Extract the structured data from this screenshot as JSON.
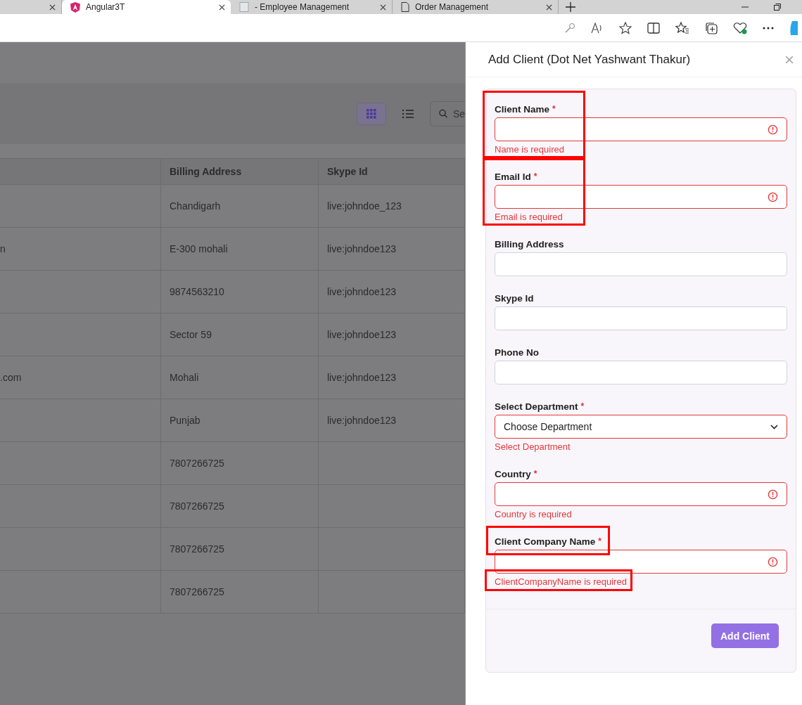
{
  "browser": {
    "tabs": [
      {
        "selected": false
      },
      {
        "title": "Angular3T",
        "selected": true
      },
      {
        "title": "- Employee Management",
        "selected": false
      },
      {
        "title": "Order Management",
        "selected": false
      }
    ]
  },
  "page": {
    "toolbar": {
      "grid_view_selected": true,
      "search_placeholder": "Se"
    },
    "table": {
      "columns": [
        "",
        "Billing Address",
        "Skype Id"
      ],
      "rows": [
        [
          "",
          "Chandigarh",
          "live:johndoe_123"
        ],
        [
          "n",
          "E-300 mohali",
          "live:johndoe123"
        ],
        [
          "",
          "9874563210",
          "live:johndoe123"
        ],
        [
          "",
          "Sector 59",
          "live:johndoe123"
        ],
        [
          ".com",
          "Mohali",
          "live:johndoe123"
        ],
        [
          "",
          "Punjab",
          "live:johndoe123"
        ],
        [
          "",
          "7807266725",
          ""
        ],
        [
          "",
          "7807266725",
          ""
        ],
        [
          "",
          "7807266725",
          ""
        ],
        [
          "",
          "7807266725",
          ""
        ]
      ]
    }
  },
  "drawer": {
    "title": "Add Client (Dot Net Yashwant Thakur)",
    "fields": [
      {
        "kind": "text",
        "label": "Client Name",
        "required_mark": "*",
        "error": "Name is required",
        "highlight_block": true
      },
      {
        "kind": "text",
        "label": "Email Id",
        "required_mark": "*",
        "error": "Email is required",
        "highlight_block": true
      },
      {
        "kind": "text",
        "label": "Billing Address"
      },
      {
        "kind": "text",
        "label": "Skype Id"
      },
      {
        "kind": "text",
        "label": "Phone No"
      },
      {
        "kind": "select",
        "label": "Select Department",
        "required_mark": "*",
        "value": "Choose Department",
        "error": "Select Department"
      },
      {
        "kind": "text",
        "label": "Country",
        "required_mark": "*",
        "error": "Country is required"
      },
      {
        "kind": "text",
        "label": "Client Company Name",
        "required_mark": "*",
        "error": "ClientCompanyName is required",
        "highlight_label": true,
        "highlight_error": true
      }
    ],
    "submit": "Add Client"
  }
}
